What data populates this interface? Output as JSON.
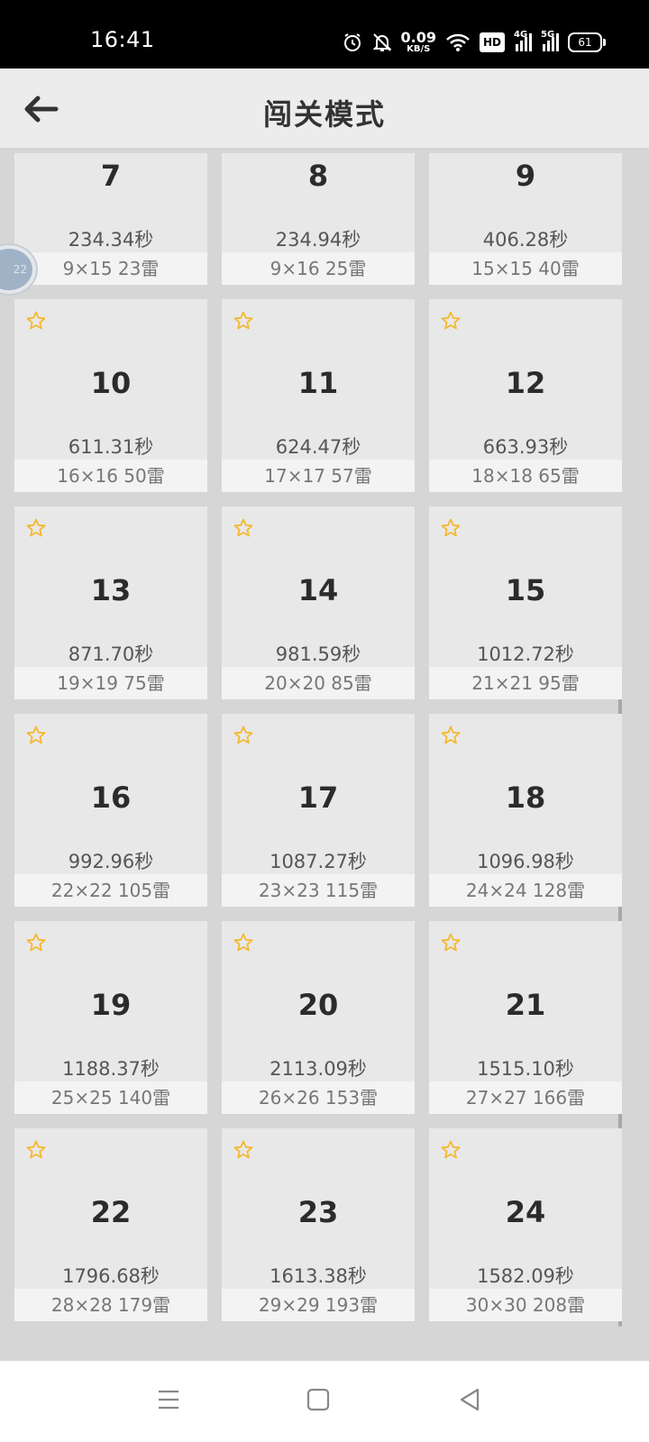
{
  "status_bar": {
    "time": "16:41",
    "net_speed_value": "0.09",
    "net_speed_unit": "KB/S",
    "hd_label": "HD",
    "sig1_label": "4G",
    "sig2_label": "5G",
    "battery": "61",
    "icons": [
      "alarm-icon",
      "mute-bell-icon",
      "wifi-icon",
      "hd-icon",
      "signal-4g-icon",
      "signal-5g-icon",
      "battery-icon"
    ]
  },
  "header": {
    "title": "闯关模式",
    "back_icon": "arrow-left-icon"
  },
  "floating_ball_label": "22",
  "colors": {
    "star": "#f5b82e",
    "card_bg": "#e8e8e8",
    "card_footer": "#f3f3f3",
    "page_bg": "#d6d6d6"
  },
  "levels": [
    {
      "number": "7",
      "time": "234.34秒",
      "size": "9×15  23雷",
      "star": false
    },
    {
      "number": "8",
      "time": "234.94秒",
      "size": "9×16  25雷",
      "star": false
    },
    {
      "number": "9",
      "time": "406.28秒",
      "size": "15×15  40雷",
      "star": false
    },
    {
      "number": "10",
      "time": "611.31秒",
      "size": "16×16  50雷",
      "star": true
    },
    {
      "number": "11",
      "time": "624.47秒",
      "size": "17×17  57雷",
      "star": true
    },
    {
      "number": "12",
      "time": "663.93秒",
      "size": "18×18  65雷",
      "star": true
    },
    {
      "number": "13",
      "time": "871.70秒",
      "size": "19×19  75雷",
      "star": true
    },
    {
      "number": "14",
      "time": "981.59秒",
      "size": "20×20  85雷",
      "star": true
    },
    {
      "number": "15",
      "time": "1012.72秒",
      "size": "21×21  95雷",
      "star": true
    },
    {
      "number": "16",
      "time": "992.96秒",
      "size": "22×22  105雷",
      "star": true
    },
    {
      "number": "17",
      "time": "1087.27秒",
      "size": "23×23  115雷",
      "star": true
    },
    {
      "number": "18",
      "time": "1096.98秒",
      "size": "24×24  128雷",
      "star": true
    },
    {
      "number": "19",
      "time": "1188.37秒",
      "size": "25×25  140雷",
      "star": true
    },
    {
      "number": "20",
      "time": "2113.09秒",
      "size": "26×26  153雷",
      "star": true
    },
    {
      "number": "21",
      "time": "1515.10秒",
      "size": "27×27  166雷",
      "star": true
    },
    {
      "number": "22",
      "time": "1796.68秒",
      "size": "28×28  179雷",
      "star": true
    },
    {
      "number": "23",
      "time": "1613.38秒",
      "size": "29×29  193雷",
      "star": true
    },
    {
      "number": "24",
      "time": "1582.09秒",
      "size": "30×30  208雷",
      "star": true
    }
  ],
  "nav_bar": {
    "icons": [
      "menu-icon",
      "home-square-icon",
      "back-triangle-icon"
    ]
  }
}
